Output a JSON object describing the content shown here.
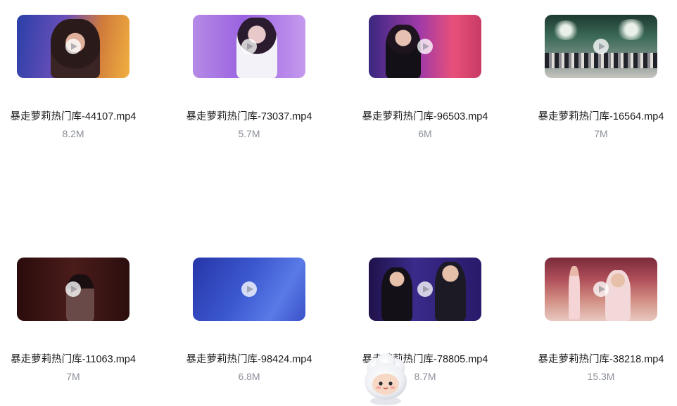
{
  "files": [
    {
      "name": "暴走萝莉热门库-44107.mp4",
      "size": "8.2M",
      "thumb_icon": "play-icon"
    },
    {
      "name": "暴走萝莉热门库-73037.mp4",
      "size": "5.7M",
      "thumb_icon": "play-icon"
    },
    {
      "name": "暴走萝莉热门库-96503.mp4",
      "size": "6M",
      "thumb_icon": "play-icon"
    },
    {
      "name": "暴走萝莉热门库-16564.mp4",
      "size": "7M",
      "thumb_icon": "play-icon"
    },
    {
      "name": "暴走萝莉热门库-11063.mp4",
      "size": "7M",
      "thumb_icon": "play-icon"
    },
    {
      "name": "暴走萝莉热门库-98424.mp4",
      "size": "6.8M",
      "thumb_icon": "play-icon"
    },
    {
      "name": "暴走萝莉热门库-78805.mp4",
      "size": "8.7M",
      "thumb_icon": "play-icon"
    },
    {
      "name": "暴走萝莉热门库-38218.mp4",
      "size": "15.3M",
      "thumb_icon": "play-icon"
    }
  ],
  "colors": {
    "file_name_text": "#1c1c1c",
    "file_size_text": "#8a8f99",
    "background": "#ffffff"
  },
  "overlay": {
    "icon": "mascot-icon"
  }
}
